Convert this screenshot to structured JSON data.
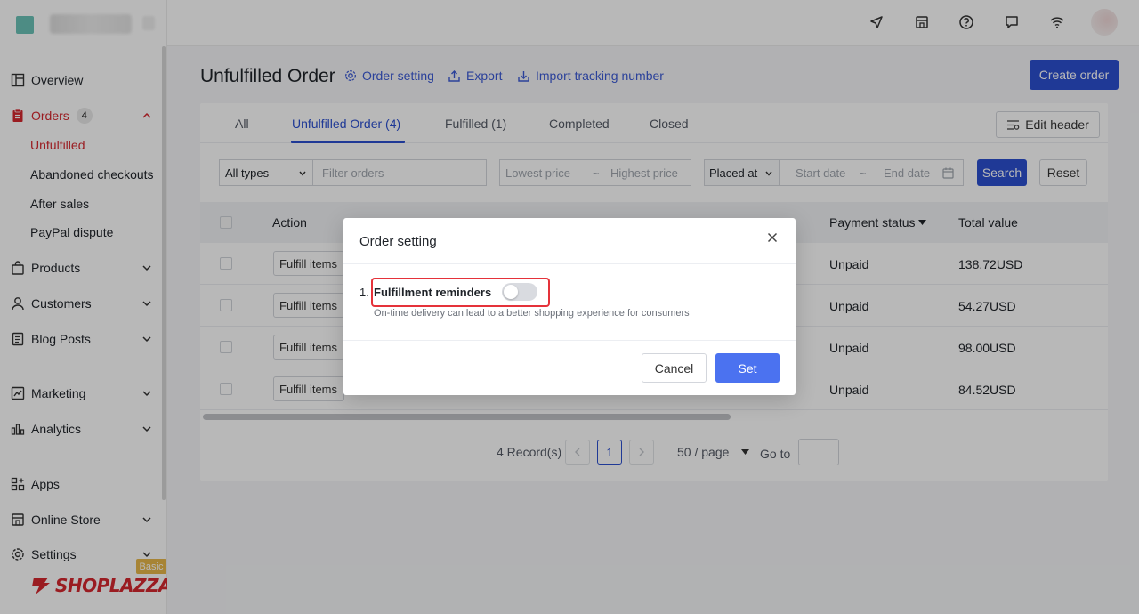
{
  "sidebar": {
    "items": {
      "overview": "Overview",
      "orders": "Orders",
      "orders_badge": "4",
      "products": "Products",
      "customers": "Customers",
      "blog_posts": "Blog Posts",
      "marketing": "Marketing",
      "analytics": "Analytics",
      "apps": "Apps",
      "online_store": "Online Store",
      "settings": "Settings"
    },
    "order_sub": {
      "unfulfilled": "Unfulfilled",
      "abandoned": "Abandoned checkouts",
      "after_sales": "After sales",
      "paypal": "PayPal dispute"
    },
    "plan_tag": "Basic",
    "logo_text": "SHOPLAZZA"
  },
  "header": {
    "title": "Unfulfilled Order",
    "order_setting": "Order setting",
    "export": "Export",
    "import_tracking": "Import tracking number",
    "create_order": "Create order"
  },
  "tabs": {
    "all": "All",
    "unfulfilled": "Unfulfilled Order  (4)",
    "fulfilled": "Fulfilled  (1)",
    "completed": "Completed",
    "closed": "Closed",
    "edit_header": "Edit header"
  },
  "filters": {
    "type": "All types",
    "filter_placeholder": "Filter orders",
    "lowest_price": "Lowest price",
    "tilde": "~",
    "highest_price": "Highest price",
    "placed_at": "Placed at",
    "start_date": "Start date",
    "end_date": "End date",
    "search": "Search",
    "reset": "Reset"
  },
  "table": {
    "col_action": "Action",
    "col_payment": "Payment status",
    "col_total": "Total value",
    "fulfill_label": "Fulfill items",
    "rows": [
      {
        "payment": "Unpaid",
        "total": "138.72USD"
      },
      {
        "payment": "Unpaid",
        "total": "54.27USD"
      },
      {
        "payment": "Unpaid",
        "total": "98.00USD"
      },
      {
        "payment": "Unpaid",
        "total": "84.52USD"
      }
    ]
  },
  "pagination": {
    "records": "4 Record(s)",
    "current_page": "1",
    "per_page": "50 / page",
    "goto": "Go to"
  },
  "modal": {
    "title": "Order setting",
    "option_number": "1.",
    "option_label": "Fulfillment reminders",
    "option_desc": "On-time delivery can lead to a better shopping experience for consumers",
    "toggle_on": false,
    "cancel": "Cancel",
    "set": "Set"
  },
  "colors": {
    "brand_red": "#d6282f",
    "primary_blue": "#2b4fd0",
    "set_blue": "#4b72f0",
    "highlight_red": "#e5323a"
  }
}
